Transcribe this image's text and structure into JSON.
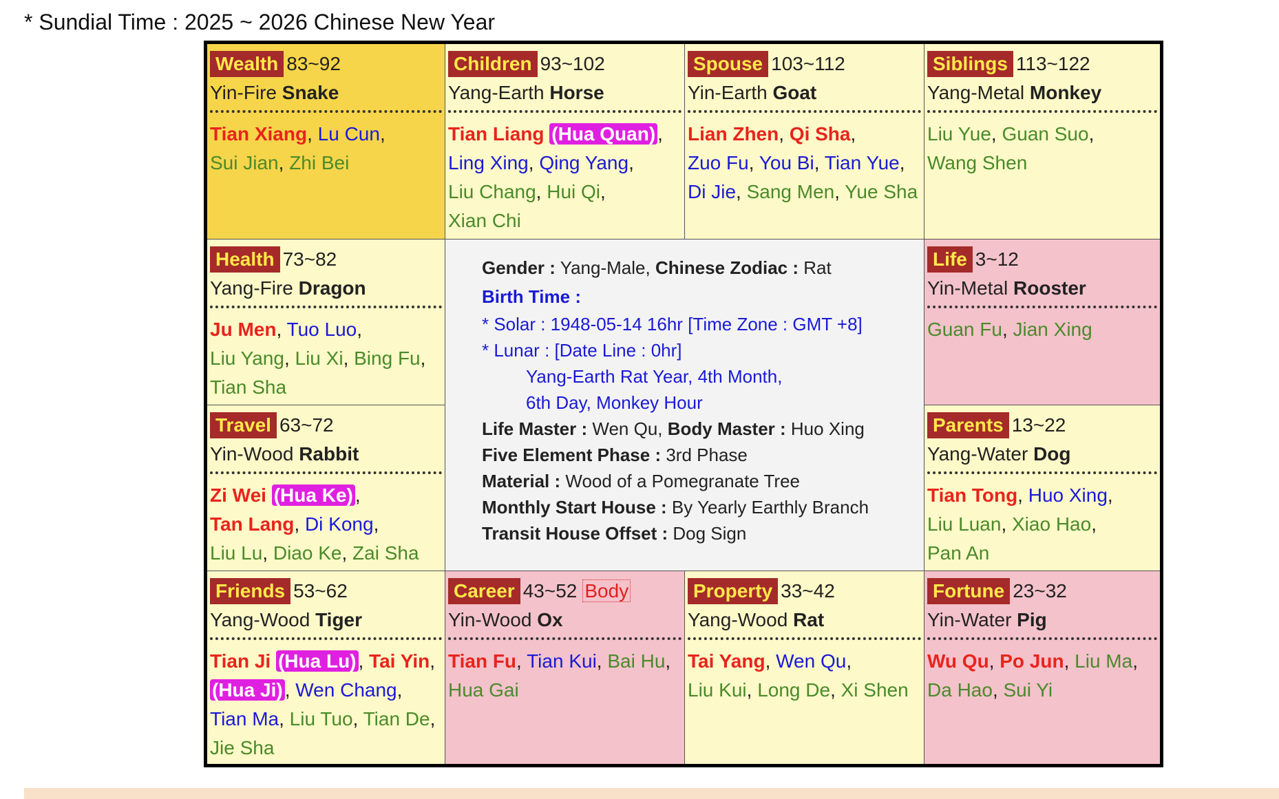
{
  "title": "* Sundial Time : 2025 ~ 2026 Chinese New Year",
  "palaces": [
    {
      "key": "wealth",
      "name": "Wealth",
      "age": "83~92",
      "branch_prefix": "Yin-Fire",
      "branch_animal": "Snake",
      "bg": "gold",
      "stars": [
        {
          "t": "Tian Xiang",
          "c": "main"
        },
        {
          "t": "Lu Cun",
          "c": "blue"
        },
        {
          "br": true
        },
        {
          "t": "Sui Jian",
          "c": "green"
        },
        {
          "t": "Zhi Bei",
          "c": "green"
        }
      ]
    },
    {
      "key": "children",
      "name": "Children",
      "age": "93~102",
      "branch_prefix": "Yang-Earth",
      "branch_animal": "Horse",
      "bg": "yellow",
      "stars": [
        {
          "t": "Tian Liang",
          "c": "main",
          "hua": "(Hua Quan)"
        },
        {
          "br": true
        },
        {
          "t": "Ling Xing",
          "c": "blue"
        },
        {
          "t": "Qing Yang",
          "c": "blue"
        },
        {
          "br": true
        },
        {
          "t": "Liu Chang",
          "c": "green"
        },
        {
          "t": "Hui Qi",
          "c": "green"
        },
        {
          "br": true
        },
        {
          "t": "Xian Chi",
          "c": "green"
        }
      ]
    },
    {
      "key": "spouse",
      "name": "Spouse",
      "age": "103~112",
      "branch_prefix": "Yin-Earth",
      "branch_animal": "Goat",
      "bg": "yellow",
      "stars": [
        {
          "t": "Lian Zhen",
          "c": "main"
        },
        {
          "t": "Qi Sha",
          "c": "main"
        },
        {
          "br": true
        },
        {
          "t": "Zuo Fu",
          "c": "blue"
        },
        {
          "t": "You Bi",
          "c": "blue"
        },
        {
          "t": "Tian Yue",
          "c": "blue"
        },
        {
          "br": true
        },
        {
          "t": "Di Jie",
          "c": "blue"
        },
        {
          "t": "Sang Men",
          "c": "green"
        },
        {
          "t": "Yue Sha",
          "c": "green"
        }
      ]
    },
    {
      "key": "siblings",
      "name": "Siblings",
      "age": "113~122",
      "branch_prefix": "Yang-Metal",
      "branch_animal": "Monkey",
      "bg": "yellow",
      "stars": [
        {
          "t": "Liu Yue",
          "c": "green"
        },
        {
          "t": "Guan Suo",
          "c": "green"
        },
        {
          "br": true
        },
        {
          "t": "Wang Shen",
          "c": "green"
        }
      ]
    },
    {
      "key": "health",
      "name": "Health",
      "age": "73~82",
      "branch_prefix": "Yang-Fire",
      "branch_animal": "Dragon",
      "bg": "yellow",
      "stars": [
        {
          "t": "Ju Men",
          "c": "main"
        },
        {
          "t": "Tuo Luo",
          "c": "blue"
        },
        {
          "br": true
        },
        {
          "t": "Liu Yang",
          "c": "green"
        },
        {
          "t": "Liu Xi",
          "c": "green"
        },
        {
          "t": "Bing Fu",
          "c": "green"
        },
        {
          "br": true
        },
        {
          "t": "Tian Sha",
          "c": "green"
        }
      ]
    },
    {
      "key": "life",
      "name": "Life",
      "age": "3~12",
      "branch_prefix": "Yin-Metal",
      "branch_animal": "Rooster",
      "bg": "pink",
      "stars": [
        {
          "t": "Guan Fu",
          "c": "green"
        },
        {
          "t": "Jian Xing",
          "c": "green"
        }
      ]
    },
    {
      "key": "travel",
      "name": "Travel",
      "age": "63~72",
      "branch_prefix": "Yin-Wood",
      "branch_animal": "Rabbit",
      "bg": "yellow",
      "stars": [
        {
          "t": "Zi Wei",
          "c": "main",
          "hua": "(Hua Ke)"
        },
        {
          "br": true
        },
        {
          "t": "Tan Lang",
          "c": "main"
        },
        {
          "t": "Di Kong",
          "c": "blue"
        },
        {
          "br": true
        },
        {
          "t": "Liu Lu",
          "c": "green"
        },
        {
          "t": "Diao Ke",
          "c": "green"
        },
        {
          "t": "Zai Sha",
          "c": "green"
        }
      ]
    },
    {
      "key": "parents",
      "name": "Parents",
      "age": "13~22",
      "branch_prefix": "Yang-Water",
      "branch_animal": "Dog",
      "bg": "yellow",
      "stars": [
        {
          "t": "Tian Tong",
          "c": "main"
        },
        {
          "t": "Huo Xing",
          "c": "blue"
        },
        {
          "br": true
        },
        {
          "t": "Liu Luan",
          "c": "green"
        },
        {
          "t": "Xiao Hao",
          "c": "green"
        },
        {
          "br": true
        },
        {
          "t": "Pan An",
          "c": "green"
        }
      ]
    },
    {
      "key": "friends",
      "name": "Friends",
      "age": "53~62",
      "branch_prefix": "Yang-Wood",
      "branch_animal": "Tiger",
      "bg": "yellow",
      "stars": [
        {
          "t": "Tian Ji",
          "c": "main",
          "hua": "(Hua Lu)"
        },
        {
          "t": "Tai Yin",
          "c": "main"
        },
        {
          "hua_only": "(Hua Ji)"
        },
        {
          "t": "Wen Chang",
          "c": "blue"
        },
        {
          "br": true
        },
        {
          "t": "Tian Ma",
          "c": "blue"
        },
        {
          "t": "Liu Tuo",
          "c": "green"
        },
        {
          "t": "Tian De",
          "c": "green"
        },
        {
          "br": true
        },
        {
          "t": "Jie Sha",
          "c": "green"
        }
      ]
    },
    {
      "key": "career",
      "name": "Career",
      "age": "43~52",
      "body": "Body",
      "branch_prefix": "Yin-Wood",
      "branch_animal": "Ox",
      "bg": "pink",
      "stars": [
        {
          "t": "Tian Fu",
          "c": "main"
        },
        {
          "t": "Tian Kui",
          "c": "blue"
        },
        {
          "t": "Bai Hu",
          "c": "green"
        },
        {
          "br": true
        },
        {
          "t": "Hua Gai",
          "c": "green"
        }
      ]
    },
    {
      "key": "property",
      "name": "Property",
      "age": "33~42",
      "branch_prefix": "Yang-Wood",
      "branch_animal": "Rat",
      "bg": "yellow",
      "stars": [
        {
          "t": "Tai Yang",
          "c": "main"
        },
        {
          "t": "Wen Qu",
          "c": "blue"
        },
        {
          "br": true
        },
        {
          "t": "Liu Kui",
          "c": "green"
        },
        {
          "t": "Long De",
          "c": "green"
        },
        {
          "t": "Xi Shen",
          "c": "green"
        }
      ]
    },
    {
      "key": "fortune",
      "name": "Fortune",
      "age": "23~32",
      "branch_prefix": "Yin-Water",
      "branch_animal": "Pig",
      "bg": "pink",
      "stars": [
        {
          "t": "Wu Qu",
          "c": "main"
        },
        {
          "t": "Po Jun",
          "c": "main"
        },
        {
          "t": "Liu Ma",
          "c": "green"
        },
        {
          "br": true
        },
        {
          "t": "Da Hao",
          "c": "green"
        },
        {
          "t": "Sui Yi",
          "c": "green"
        }
      ]
    }
  ],
  "center": {
    "gender_label": "Gender :",
    "gender": "Yang-Male,",
    "zodiac_label": "Chinese Zodiac :",
    "zodiac": "Rat",
    "birth_time_label": "Birth Time :",
    "solar": "* Solar : 1948-05-14 16hr [Time Zone : GMT +8]",
    "lunar": "* Lunar : [Date Line : 0hr]",
    "lunar_line1": "Yang-Earth Rat Year, 4th Month,",
    "lunar_line2": "6th Day, Monkey Hour",
    "life_master_label": "Life Master :",
    "life_master": "Wen Qu,",
    "body_master_label": "Body Master :",
    "body_master": "Huo Xing",
    "five_element_label": "Five Element Phase :",
    "five_element": "3rd Phase",
    "material_label": "Material :",
    "material": "Wood of a Pomegranate Tree",
    "monthly_label": "Monthly Start House :",
    "monthly": "By Yearly Earthly Branch",
    "transit_label": "Transit House Offset :",
    "transit": "Dog Sign"
  }
}
